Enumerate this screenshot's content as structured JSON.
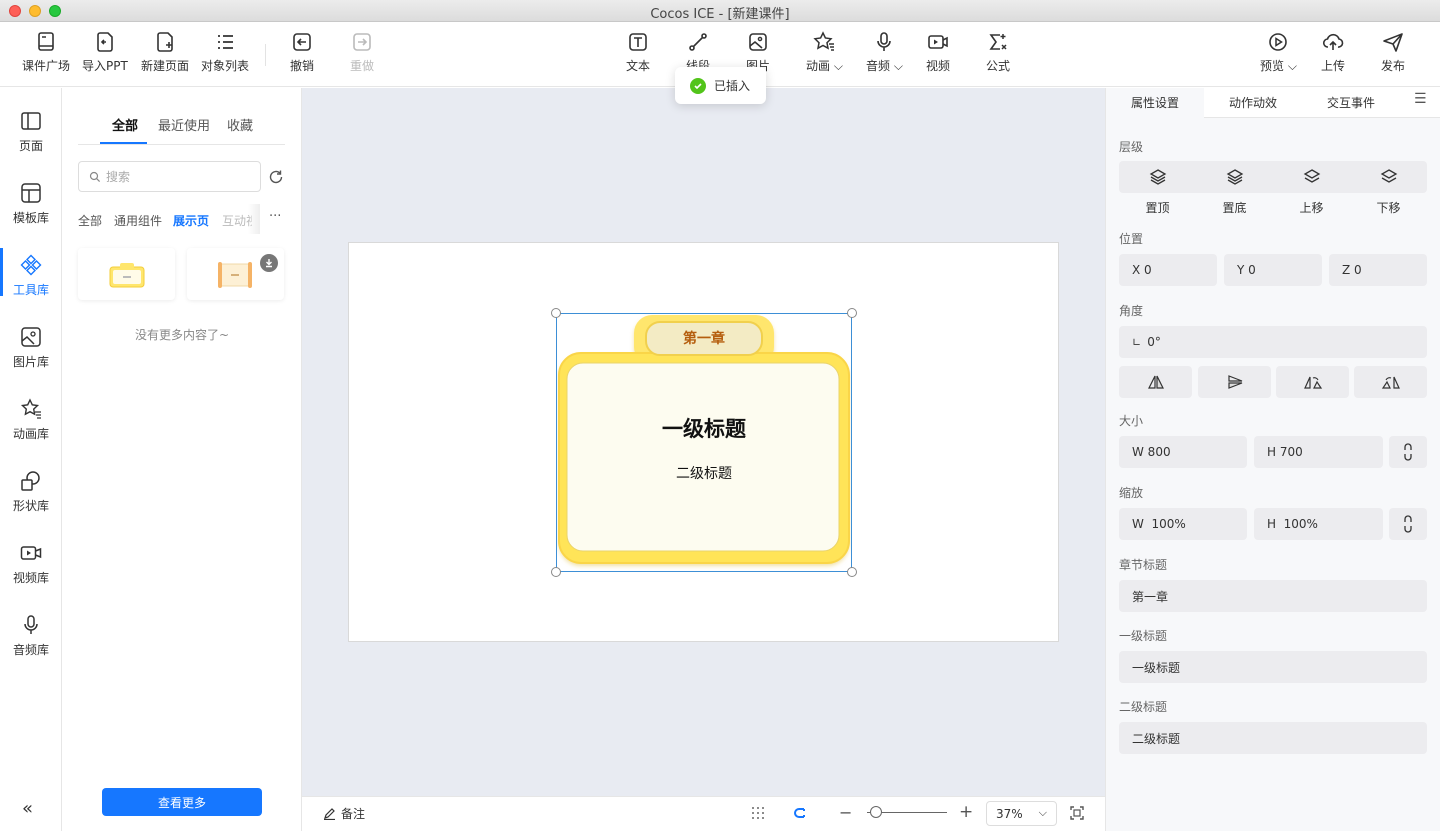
{
  "window": {
    "title": "Cocos ICE - [新建课件]"
  },
  "toast": {
    "text": "已插入"
  },
  "toolbar": {
    "courseware_plaza": "课件广场",
    "import_ppt": "导入PPT",
    "new_page": "新建页面",
    "object_list": "对象列表",
    "undo": "撤销",
    "redo": "重做",
    "text": "文本",
    "line": "线段",
    "image": "图片",
    "animation": "动画",
    "audio": "音频",
    "video": "视频",
    "formula": "公式",
    "preview": "预览",
    "upload": "上传",
    "publish": "发布"
  },
  "sidebar": {
    "items": [
      {
        "label": "页面",
        "icon": "page-icon"
      },
      {
        "label": "模板库",
        "icon": "template-icon"
      },
      {
        "label": "工具库",
        "icon": "tools-icon"
      },
      {
        "label": "图片库",
        "icon": "image-icon"
      },
      {
        "label": "动画库",
        "icon": "star-icon"
      },
      {
        "label": "形状库",
        "icon": "shape-icon"
      },
      {
        "label": "视频库",
        "icon": "video-icon"
      },
      {
        "label": "音频库",
        "icon": "mic-icon"
      }
    ],
    "active": "工具库"
  },
  "panel": {
    "tabs": [
      "全部",
      "最近使用",
      "收藏"
    ],
    "active_tab": "全部",
    "search_placeholder": "搜索",
    "categories": [
      "全部",
      "通用组件",
      "展示页",
      "互动视"
    ],
    "active_category": "展示页",
    "empty_text": "没有更多内容了~",
    "more_button": "查看更多"
  },
  "canvas": {
    "chapter": "第一章",
    "heading1": "一级标题",
    "heading2": "二级标题"
  },
  "bottombar": {
    "notes": "备注",
    "zoom": "37%"
  },
  "properties": {
    "tabs": [
      "属性设置",
      "动作动效",
      "交互事件"
    ],
    "active_tab": "属性设置",
    "layer_label": "层级",
    "layer_buttons": [
      "置顶",
      "置底",
      "上移",
      "下移"
    ],
    "position_label": "位置",
    "x": "X 0",
    "y": "Y 0",
    "z": "Z 0",
    "angle_label": "角度",
    "angle": "0°",
    "size_label": "大小",
    "w": "W 800",
    "h": "H 700",
    "scale_label": "缩放",
    "scale_w": "W  100%",
    "scale_h": "H  100%",
    "chapter_label": "章节标题",
    "chapter_value": "第一章",
    "h1_label": "一级标题",
    "h1_value": "一级标题",
    "h2_label": "二级标题",
    "h2_value": "二级标题"
  },
  "colors": {
    "accent": "#1677ff",
    "card_yellow": "#ffe66d",
    "success": "#52c41a"
  }
}
